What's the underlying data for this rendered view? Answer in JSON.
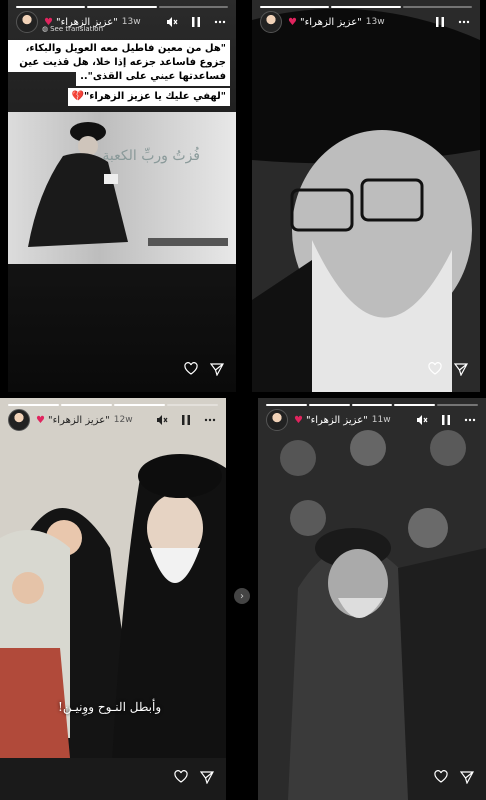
{
  "user": {
    "name": "\"عزيز الزهراء\"",
    "heart": "♥"
  },
  "stories": [
    {
      "time": "13w",
      "see_translation": "See translation",
      "quote": [
        "\"هل من معين فاطيل معه العويل والبكاء، هل من",
        "جزوع فاساعد جزعه إذا خلا، هل قذيت عين",
        "فساعدتها عيني على القذى\".."
      ],
      "quote2": "\"لهفي عليك يا عزيز الزهراء\"💔",
      "calligraphy": "فُزتُ وربِّ الكعبة"
    },
    {
      "time": "13w"
    },
    {
      "time": "12w",
      "caption": "وأبطل النـوح ووِنيـن!"
    },
    {
      "time": "11w"
    }
  ],
  "icons": {
    "mute": "mute-icon",
    "pause": "pause-icon",
    "more": "more-icon",
    "like": "heart-icon",
    "share": "send-icon",
    "next": "chevron-right-icon"
  }
}
